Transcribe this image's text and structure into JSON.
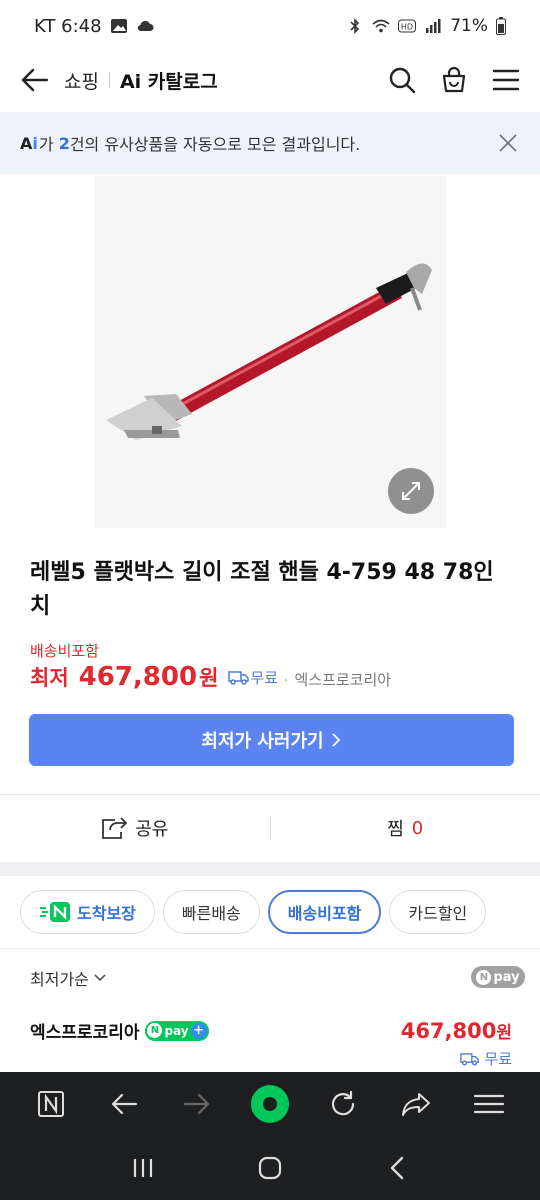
{
  "status": {
    "carrier_time": "KT 6:48",
    "battery": "71%"
  },
  "header": {
    "crumb": "쇼핑",
    "title": "Ai 카탈로그"
  },
  "banner": {
    "ai_a": "A",
    "ai_i": "i",
    "pre": "가 ",
    "count": "2",
    "post": "건의 유사상품을 자동으로 모은 결과입니다."
  },
  "product": {
    "title": "레벨5 플랫박스 길이 조절 핸들 4-759 48 78인치",
    "shipping_included": "배송비포함",
    "lowest_label": "최저",
    "price": "467,800",
    "won": "원",
    "free_ship": "무료",
    "dot": "·",
    "seller": "엑스프로코리아",
    "buy_button": "최저가 사러가기"
  },
  "actions": {
    "share": "공유",
    "wish": "찜",
    "wish_count": "0"
  },
  "chips": [
    {
      "label": "도착보장"
    },
    {
      "label": "빠른배송"
    },
    {
      "label": "배송비포함"
    },
    {
      "label": "카드할인"
    }
  ],
  "sort": {
    "label": "최저가순"
  },
  "npay": {
    "label": "pay",
    "n": "N"
  },
  "offer": {
    "seller": "엑스프로코리아",
    "price": "467,800",
    "won": "원",
    "ship": "무료"
  },
  "colors": {
    "accent": "#5b84f0",
    "price_red": "#e0282e",
    "npay_green": "#03c75a"
  },
  "icons": [
    "back-arrow-icon",
    "search-icon",
    "cart-icon",
    "menu-icon",
    "close-icon",
    "expand-icon",
    "truck-icon",
    "share-icon",
    "naver-n-icon",
    "browser-back-icon",
    "browser-forward-icon",
    "home-icon",
    "reload-icon",
    "share-forward-icon",
    "hamburger-icon",
    "recents-icon",
    "home-circle-icon",
    "system-back-icon"
  ]
}
